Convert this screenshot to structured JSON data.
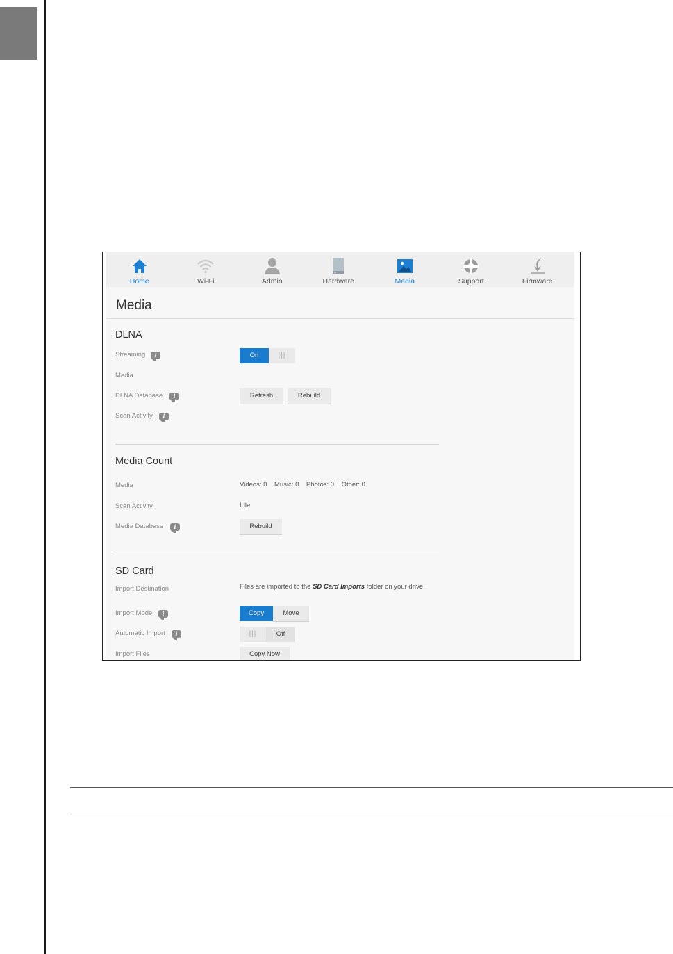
{
  "nav": {
    "items": [
      {
        "label": "Home",
        "icon": "home-icon",
        "active": true
      },
      {
        "label": "Wi-Fi",
        "icon": "wifi-icon",
        "active": false
      },
      {
        "label": "Admin",
        "icon": "admin-user-icon",
        "active": false
      },
      {
        "label": "Hardware",
        "icon": "hardware-drive-icon",
        "active": false
      },
      {
        "label": "Media",
        "icon": "media-picture-icon",
        "active": true
      },
      {
        "label": "Support",
        "icon": "support-lifebuoy-icon",
        "active": false
      },
      {
        "label": "Firmware",
        "icon": "firmware-download-icon",
        "active": false
      }
    ]
  },
  "page": {
    "title": "Media"
  },
  "dlna": {
    "title": "DLNA",
    "streaming_label": "Streaming",
    "streaming_toggle": {
      "state": "On",
      "grip": "|||"
    },
    "media_label": "Media",
    "database_label": "DLNA Database",
    "refresh_button": "Refresh",
    "rebuild_button": "Rebuild",
    "scan_activity_label": "Scan Activity"
  },
  "media_count": {
    "title": "Media Count",
    "media_label": "Media",
    "counts_text": "Videos: 0    Music: 0    Photos: 0    Other: 0",
    "scan_activity_label": "Scan Activity",
    "scan_activity_value": "Idle",
    "database_label": "Media Database",
    "rebuild_button": "Rebuild"
  },
  "sd_card": {
    "title": "SD Card",
    "import_destination_label": "Import Destination",
    "import_destination_prefix": "Files are imported to the ",
    "import_destination_folder": "SD Card Imports",
    "import_destination_suffix": " folder on your drive",
    "import_mode_label": "Import Mode",
    "copy_option": "Copy",
    "move_option": "Move",
    "selected_mode": "Copy",
    "automatic_import_label": "Automatic Import",
    "automatic_import_toggle": {
      "state": "Off",
      "grip": "|||"
    },
    "import_files_label": "Import Files",
    "copy_now_button": "Copy Now"
  },
  "colors": {
    "accent": "#1a7ccf",
    "active_nav": "#1d7fd1"
  }
}
